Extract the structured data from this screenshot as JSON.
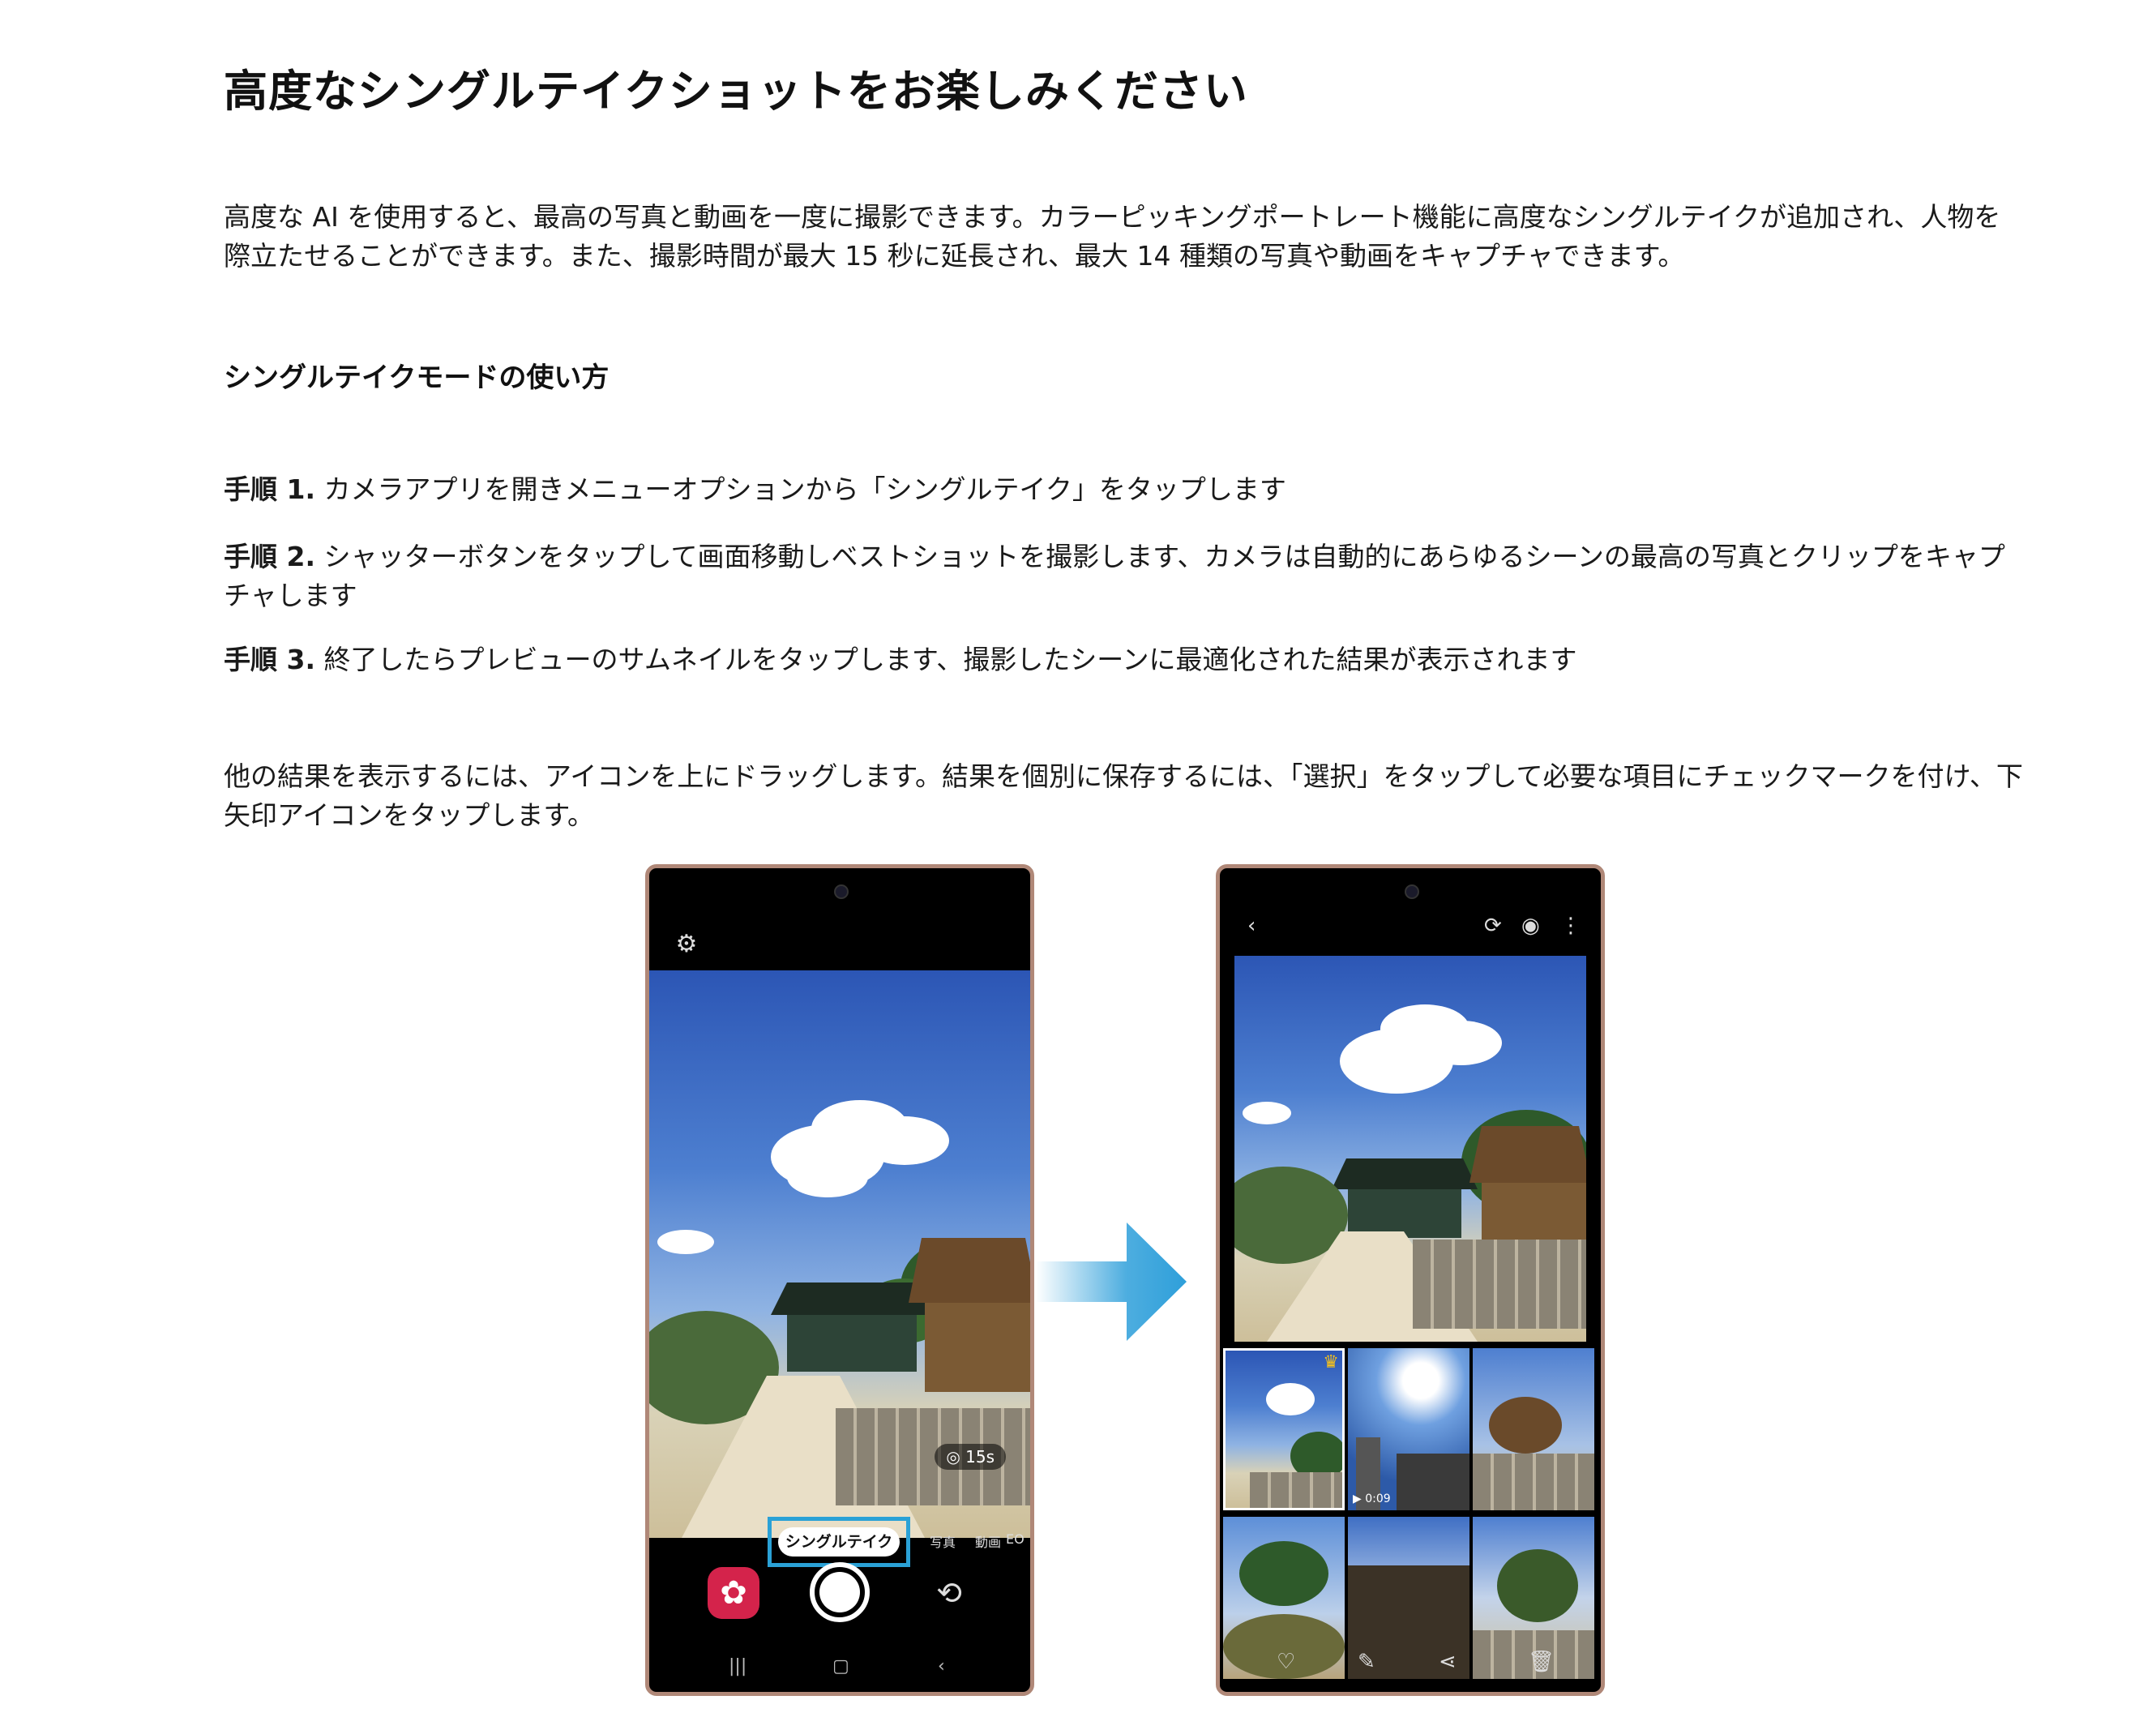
{
  "page": {
    "title": "高度なシングルテイクショットをお楽しみください",
    "intro": "高度な AI を使用すると、最高の写真と動画を一度に撮影できます。カラーピッキングポートレート機能に高度なシングルテイクが追加され、人物を際立たせることができます。また、撮影時間が最大 15 秒に延長され、最大 14 種類の写真や動画をキャプチャできます。",
    "subheading": "シングルテイクモードの使い方",
    "steps": [
      {
        "label": "手順 1.",
        "text": " カメラアプリを開きメニューオプションから「シングルテイク」をタップします"
      },
      {
        "label": "手順 2.",
        "text": " シャッターボタンをタップして画面移動しベストショットを撮影します、カメラは自動的にあらゆるシーンの最高の写真とクリップをキャプチャします"
      },
      {
        "label": "手順 3.",
        "text": " 終了したらプレビューのサムネイルをタップします、撮影したシーンに最適化された結果が表示されます"
      }
    ],
    "more_info": "他の結果を表示するには、アイコンを上にドラッグします。結果を個別に保存するには、「選択」をタップして必要な項目にチェックマークを付け、下矢印アイコンをタップします。"
  },
  "phone_camera": {
    "timer_label": "◎ 15s",
    "mode_selected": "シングルテイク",
    "mode_photo": "写真",
    "mode_video": "動画",
    "mode_extra": "EO"
  },
  "phone_gallery": {
    "video_duration": "▶ 0:09"
  },
  "colors": {
    "highlight_box": "#2aa1d6",
    "arrow": "#2e9fda",
    "bixby": "#d4234b",
    "crown": "#f7c21b"
  },
  "icons": [
    "settings-gear-icon",
    "flip-camera-icon",
    "back-icon",
    "recents-icon",
    "home-icon",
    "crown-icon",
    "heart-icon",
    "edit-icon",
    "share-icon",
    "trash-icon",
    "eye-icon",
    "more-icon",
    "remaster-icon"
  ]
}
